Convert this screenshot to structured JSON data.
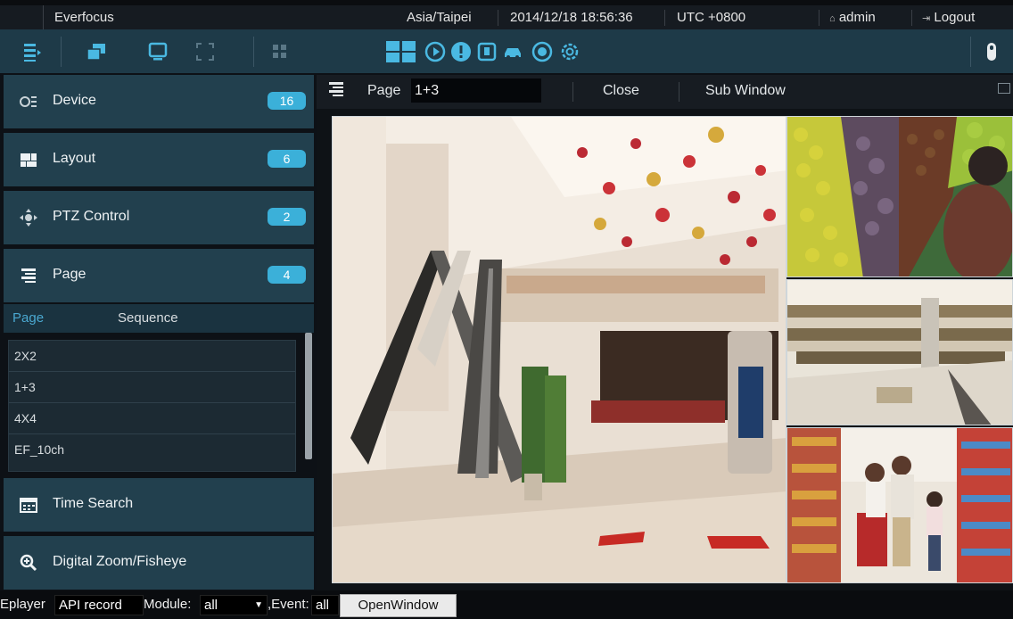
{
  "topbar": {
    "brand": "Everfocus",
    "timezone": "Asia/Taipei",
    "datetime": "2014/12/18 18:56:36",
    "utc": "UTC +0800",
    "user": "admin",
    "logout": "Logout"
  },
  "toolbar": {
    "icons": [
      "menu-icon",
      "windows-icon",
      "monitor-icon",
      "fullscreen-icon",
      "grid-icon",
      "layout-icon",
      "playback-icon",
      "alarm-icon",
      "export-icon",
      "vehicle-icon",
      "disk-icon",
      "settings-icon",
      "lock-icon"
    ],
    "accent": "#4ab9e2"
  },
  "sidebar": {
    "sections": [
      {
        "label": "Device",
        "badge": "16",
        "icon": "device-icon"
      },
      {
        "label": "Layout",
        "badge": "6",
        "icon": "layout-icon"
      },
      {
        "label": "PTZ Control",
        "badge": "2",
        "icon": "ptz-icon"
      },
      {
        "label": "Page",
        "badge": "4",
        "icon": "page-list-icon"
      }
    ],
    "subtabs": {
      "active": "Page",
      "other": "Sequence"
    },
    "pages": [
      "2X2",
      "1+3",
      "4X4",
      "EF_10ch"
    ],
    "extra": [
      {
        "label": "Time Search",
        "icon": "calendar-icon"
      },
      {
        "label": "Digital Zoom/Fisheye",
        "icon": "zoom-icon"
      }
    ]
  },
  "main": {
    "page_label": "Page",
    "page_value": "1+3",
    "close": "Close",
    "sub_window": "Sub Window"
  },
  "bottombar": {
    "player_label": "Eplayer",
    "api_value": "API record",
    "module_label": "Module:",
    "module_value": "all",
    "event_label": ",Event:",
    "event_value": "all",
    "open_window": "OpenWindow"
  },
  "colors": {
    "badge": "#3bb0d9",
    "panel": "#22404e",
    "toolbar": "#1e3a48",
    "tab_active": "#4aa8d0"
  }
}
